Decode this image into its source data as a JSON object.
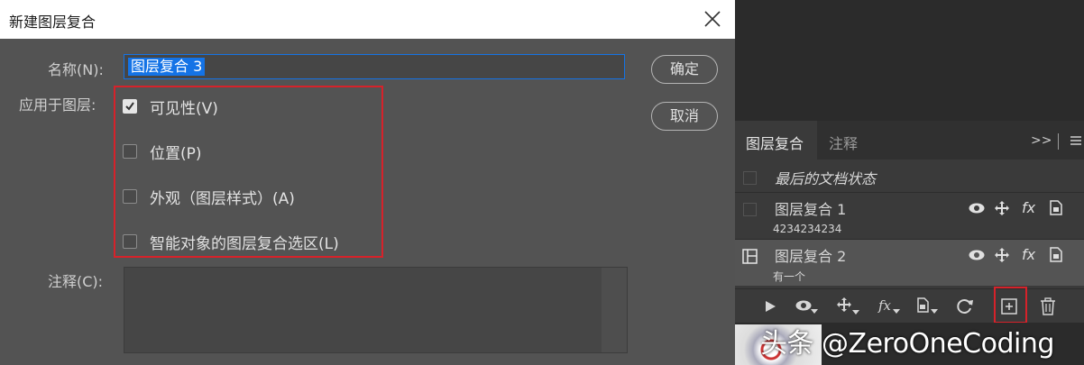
{
  "dialog": {
    "title": "新建图层复合",
    "name_label": "名称(N):",
    "name_value": "图层复合 3",
    "apply_label": "应用于图层:",
    "options": [
      {
        "label": "可见性(V)",
        "checked": true
      },
      {
        "label": "位置(P)",
        "checked": false
      },
      {
        "label": "外观（图层样式）(A)",
        "checked": false
      },
      {
        "label": "智能对象的图层复合选区(L)",
        "checked": false
      }
    ],
    "comment_label": "注释(C):",
    "comment_value": "",
    "ok_label": "确定",
    "cancel_label": "取消"
  },
  "panel": {
    "tabs": [
      "图层复合",
      "注释"
    ],
    "rows": [
      {
        "title": "最后的文档状态",
        "subtitle": ""
      },
      {
        "title": "图层复合 1",
        "subtitle": "4234234234"
      },
      {
        "title": "图层复合 2",
        "subtitle": "有一个"
      }
    ],
    "fx_label": "fx",
    "menu_more": ">>"
  },
  "watermark": "头条 @ZeroOneCoding",
  "colors": {
    "accent": "#1473e6",
    "highlight_border": "#d6222a",
    "dialog_bg": "#535353",
    "panel_bg": "#3a3a3a"
  }
}
